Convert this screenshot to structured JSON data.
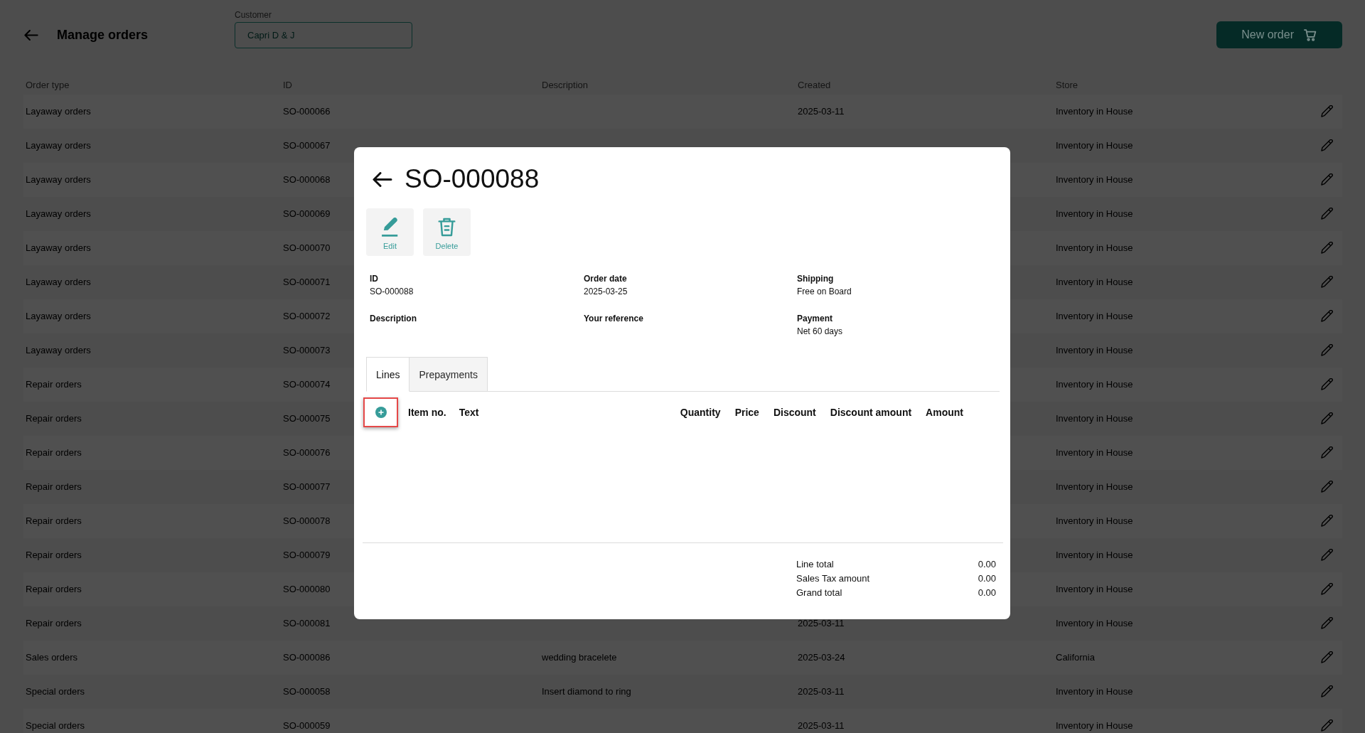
{
  "header": {
    "title": "Manage orders",
    "customer_field": {
      "label": "Customer",
      "value": "Capri D & J"
    },
    "new_order_button": {
      "label": "New order"
    }
  },
  "table": {
    "columns": [
      "Order type",
      "ID",
      "Description",
      "Created",
      "Store"
    ],
    "rows": [
      {
        "order_type": "Layaway orders",
        "id": "SO-000066",
        "created": "2025-03-11",
        "store": "Inventory in House"
      },
      {
        "order_type": "Layaway orders",
        "id": "SO-000067",
        "store": "Inventory in House"
      },
      {
        "order_type": "Layaway orders",
        "id": "SO-000068",
        "store": "Inventory in House"
      },
      {
        "order_type": "Layaway orders",
        "id": "SO-000069",
        "store": "Inventory in House"
      },
      {
        "order_type": "Layaway orders",
        "id": "SO-000070",
        "store": "Inventory in House"
      },
      {
        "order_type": "Layaway orders",
        "id": "SO-000071",
        "store": "Inventory in House"
      },
      {
        "order_type": "Layaway orders",
        "id": "SO-000072",
        "store": "Inventory in House"
      },
      {
        "order_type": "Layaway orders",
        "id": "SO-000073",
        "store": "Inventory in House"
      },
      {
        "order_type": "Repair orders",
        "id": "SO-000074",
        "store": "Inventory in House"
      },
      {
        "order_type": "Repair orders",
        "id": "SO-000075",
        "store": "Inventory in House"
      },
      {
        "order_type": "Repair orders",
        "id": "SO-000076",
        "store": "Inventory in House"
      },
      {
        "order_type": "Repair orders",
        "id": "SO-000077",
        "store": "Inventory in House"
      },
      {
        "order_type": "Repair orders",
        "id": "SO-000078",
        "store": "Inventory in House"
      },
      {
        "order_type": "Repair orders",
        "id": "SO-000079",
        "store": "Inventory in House"
      },
      {
        "order_type": "Repair orders",
        "id": "SO-000080",
        "store": "Inventory in House"
      },
      {
        "order_type": "Repair orders",
        "id": "SO-000081",
        "created": "2025-03-11",
        "store": "Inventory in House"
      },
      {
        "order_type": "Sales orders",
        "id": "SO-000086",
        "description": "wedding bracelete",
        "created": "2025-03-24",
        "store": "California"
      },
      {
        "order_type": "Special orders",
        "id": "SO-000058",
        "description": "Insert diamond to ring",
        "created": "2025-03-11",
        "store": "Inventory in House"
      },
      {
        "order_type": "Special orders",
        "id": "SO-000059",
        "created": "2025-03-11",
        "store": "Inventory in House"
      }
    ]
  },
  "dialog": {
    "title": "SO-000088",
    "actions": [
      {
        "kind": "edit",
        "label": "Edit"
      },
      {
        "kind": "delete",
        "label": "Delete"
      }
    ],
    "fields": [
      {
        "label": "ID",
        "value": "SO-000088"
      },
      {
        "label": "Order date",
        "value": "2025-03-25"
      },
      {
        "label": "Shipping",
        "value": "Free on Board"
      },
      {
        "label": "Description"
      },
      {
        "label": "Your reference"
      },
      {
        "label": "Payment",
        "value": "Net 60 days"
      }
    ],
    "tabs": [
      {
        "label": "Lines",
        "selected": true
      },
      {
        "label": "Prepayments",
        "selected": false
      }
    ],
    "lines": {
      "add_button": {
        "highlighted": true
      },
      "columns": [
        "Item no.",
        "Text",
        "Quantity",
        "Price",
        "Discount",
        "Discount amount",
        "Amount"
      ]
    },
    "totals": [
      {
        "label": "Line total",
        "value": "0.00"
      },
      {
        "label": "Sales Tax amount",
        "value": "0.00"
      },
      {
        "label": "Grand total",
        "value": "0.00"
      }
    ]
  }
}
